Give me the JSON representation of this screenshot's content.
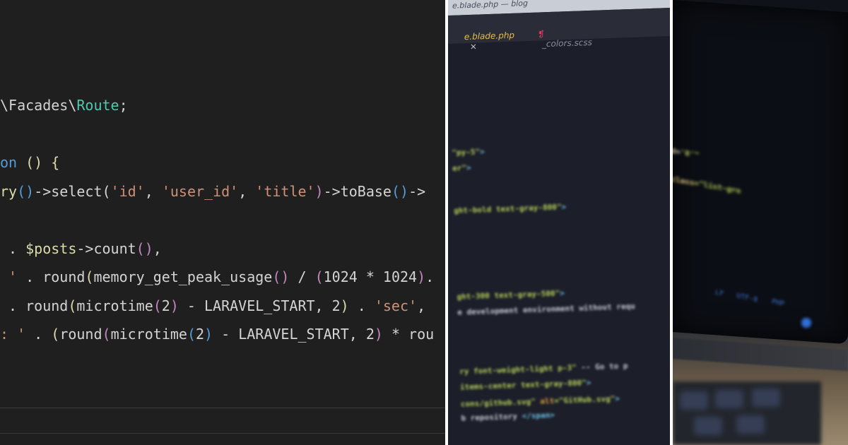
{
  "left_editor": {
    "lines": [
      {
        "tokens": [
          {
            "t": "\\Facades\\",
            "c": "#d4d4d4"
          },
          {
            "t": "Route",
            "c": "#4ec9b0"
          },
          {
            "t": ";",
            "c": "#d4d4d4"
          }
        ]
      },
      {
        "tokens": [
          {
            "t": "on ",
            "c": "#569cd6"
          },
          {
            "t": "() {",
            "c": "#dcdcaa"
          }
        ]
      },
      {
        "tokens": [
          {
            "t": "ry",
            "c": "#dcdcaa"
          },
          {
            "t": "()",
            "c": "#569cd6"
          },
          {
            "t": "->select(",
            "c": "#d4d4d4"
          },
          {
            "t": "'id'",
            "c": "#ce9178"
          },
          {
            "t": ", ",
            "c": "#d4d4d4"
          },
          {
            "t": "'user_id'",
            "c": "#ce9178"
          },
          {
            "t": ", ",
            "c": "#d4d4d4"
          },
          {
            "t": "'title'",
            "c": "#ce9178"
          },
          {
            "t": ")",
            "c": "#c586c0"
          },
          {
            "t": "->toBase",
            "c": "#d4d4d4"
          },
          {
            "t": "()",
            "c": "#569cd6"
          },
          {
            "t": "->",
            "c": "#d4d4d4"
          }
        ]
      },
      {
        "tokens": [
          {
            "t": " . ",
            "c": "#d4d4d4"
          },
          {
            "t": "$posts",
            "c": "#dcdcaa"
          },
          {
            "t": "->count",
            "c": "#d4d4d4"
          },
          {
            "t": "()",
            "c": "#c586c0"
          },
          {
            "t": ",",
            "c": "#d4d4d4"
          }
        ]
      },
      {
        "tokens": [
          {
            "t": " ' ",
            "c": "#ce9178"
          },
          {
            "t": ". round",
            "c": "#d4d4d4"
          },
          {
            "t": "(",
            "c": "#dcdcaa"
          },
          {
            "t": "memory_get_peak_usage",
            "c": "#d4d4d4"
          },
          {
            "t": "()",
            "c": "#c586c0"
          },
          {
            "t": " / ",
            "c": "#d4d4d4"
          },
          {
            "t": "(",
            "c": "#c586c0"
          },
          {
            "t": "1024 * 1024",
            "c": "#d4d4d4"
          },
          {
            "t": ")",
            "c": "#c586c0"
          },
          {
            "t": ".",
            "c": "#d4d4d4"
          }
        ]
      },
      {
        "tokens": [
          {
            "t": " . round",
            "c": "#d4d4d4"
          },
          {
            "t": "(",
            "c": "#dcdcaa"
          },
          {
            "t": "microtime",
            "c": "#d4d4d4"
          },
          {
            "t": "(",
            "c": "#c586c0"
          },
          {
            "t": "2",
            "c": "#d4d4d4"
          },
          {
            "t": ")",
            "c": "#c586c0"
          },
          {
            "t": " - LARAVEL_START, 2",
            "c": "#d4d4d4"
          },
          {
            "t": ")",
            "c": "#dcdcaa"
          },
          {
            "t": " . ",
            "c": "#d4d4d4"
          },
          {
            "t": "'sec'",
            "c": "#ce9178"
          },
          {
            "t": ",",
            "c": "#d4d4d4"
          }
        ]
      },
      {
        "tokens": [
          {
            "t": ": ' ",
            "c": "#ce9178"
          },
          {
            "t": ". ",
            "c": "#d4d4d4"
          },
          {
            "t": "(",
            "c": "#dcdcaa"
          },
          {
            "t": "round",
            "c": "#d4d4d4"
          },
          {
            "t": "(",
            "c": "#c586c0"
          },
          {
            "t": "microtime",
            "c": "#d4d4d4"
          },
          {
            "t": "(",
            "c": "#569cd6"
          },
          {
            "t": "2",
            "c": "#d4d4d4"
          },
          {
            "t": ")",
            "c": "#569cd6"
          },
          {
            "t": " - LARAVEL_START, 2",
            "c": "#d4d4d4"
          },
          {
            "t": ")",
            "c": "#c586c0"
          },
          {
            "t": " * rou",
            "c": "#d4d4d4"
          }
        ]
      }
    ]
  },
  "middle_editor": {
    "window_title": "e.blade.php — blog",
    "tabs": [
      {
        "label": "e.blade.php",
        "color": "#e8c04a",
        "close": "×"
      },
      {
        "label": "_colors.scss",
        "color": "#8a8fa0",
        "icon_color": "#e0365f"
      }
    ],
    "lines": [
      {
        "tokens": [
          {
            "t": "\"py-5\"",
            "c": "#b7d35a"
          },
          {
            "t": ">",
            "c": "#6cc4e8"
          }
        ]
      },
      {
        "tokens": [
          {
            "t": "er\"",
            "c": "#b7d35a"
          },
          {
            "t": ">",
            "c": "#6cc4e8"
          }
        ]
      },
      {
        "tokens": [
          {
            "t": "ght-bold text-gray-800\"",
            "c": "#b7d35a"
          },
          {
            "t": ">",
            "c": "#6cc4e8"
          }
        ]
      },
      {
        "tokens": [
          {
            "t": "ght-300 text-gray-500\"",
            "c": "#b7d35a"
          },
          {
            "t": ">",
            "c": "#6cc4e8"
          }
        ]
      },
      {
        "tokens": [
          {
            "t": "e development environment without requ",
            "c": "#c9ccd6"
          }
        ]
      },
      {
        "tokens": [
          {
            "t": "ry font-weight-light p-3\"",
            "c": "#b7d35a"
          },
          {
            "t": " -- Go to p",
            "c": "#c9ccd6"
          }
        ]
      },
      {
        "tokens": [
          {
            "t": "items-center text-gray-800\"",
            "c": "#b7d35a"
          },
          {
            "t": ">",
            "c": "#6cc4e8"
          }
        ]
      },
      {
        "tokens": [
          {
            "t": "cons/github.svg\"",
            "c": "#b7d35a"
          },
          {
            "t": " alt",
            "c": "#e6a23c"
          },
          {
            "t": "=\"GitHub.svg\"",
            "c": "#b7d35a"
          },
          {
            "t": ">",
            "c": "#6cc4e8"
          }
        ]
      },
      {
        "tokens": [
          {
            "t": "b repository ",
            "c": "#c9ccd6"
          },
          {
            "t": "</span>",
            "c": "#6cc4e8"
          }
        ]
      }
    ]
  },
  "right_photo": {
    "lines": [
      {
        "tokens": [
          {
            "t": "cked",
            "c": "#d9c27a"
          },
          {
            "t": "=",
            "c": "#c9ccd6"
          },
          {
            "t": "'0'\"",
            "c": "#b7d35a"
          }
        ]
      },
      {
        "tokens": [
          {
            "t": ".\" ",
            "c": "#b7d35a"
          },
          {
            "t": "class",
            "c": "#d9c27a"
          },
          {
            "t": "=\"list-gro",
            "c": "#b7d35a"
          }
        ]
      }
    ],
    "status": [
      "LF",
      "UTF-8",
      "PHP"
    ]
  },
  "colors": {
    "left_bg": "#1f1f1f",
    "middle_bg": "#1c1e29",
    "status_blue": "#2f6fd8"
  }
}
